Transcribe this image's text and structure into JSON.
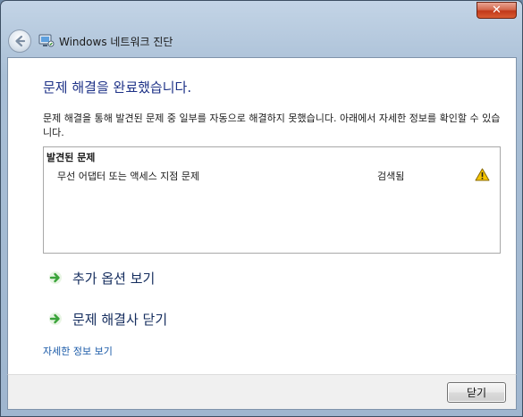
{
  "window": {
    "title": "Windows 네트워크 진단",
    "close_symbol": "✕"
  },
  "content": {
    "heading": "문제 해결을 완료했습니다.",
    "description": "문제 해결을 통해 발견된 문제 중 일부를 자동으로 해결하지 못했습니다. 아래에서 자세한 정보를 확인할 수 있습니다.",
    "problems": {
      "header": "발견된 문제",
      "items": [
        {
          "name": "무선 어댑터 또는 액세스 지점 문제",
          "status": "검색됨",
          "icon": "warning-icon"
        }
      ]
    },
    "links": {
      "more_options": "추가 옵션 보기",
      "close_troubleshooter": "문제 해결사 닫기",
      "view_details": "자세한 정보 보기"
    }
  },
  "footer": {
    "close_label": "닫기"
  },
  "colors": {
    "heading": "#1e3287",
    "link": "#1a5aa8",
    "warning": "#f5c400",
    "arrow": "#3aa33a"
  }
}
